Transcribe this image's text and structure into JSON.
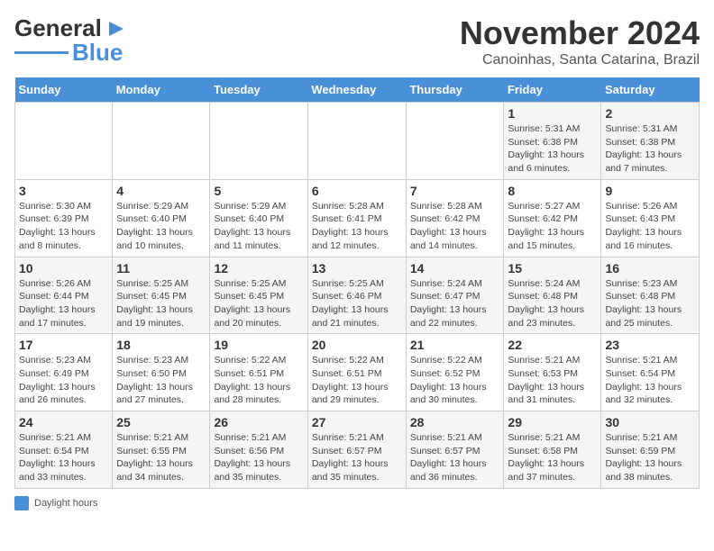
{
  "header": {
    "logo_line1": "General",
    "logo_line2": "Blue",
    "month": "November 2024",
    "location": "Canoinhas, Santa Catarina, Brazil"
  },
  "days_of_week": [
    "Sunday",
    "Monday",
    "Tuesday",
    "Wednesday",
    "Thursday",
    "Friday",
    "Saturday"
  ],
  "weeks": [
    [
      {
        "day": "",
        "info": ""
      },
      {
        "day": "",
        "info": ""
      },
      {
        "day": "",
        "info": ""
      },
      {
        "day": "",
        "info": ""
      },
      {
        "day": "",
        "info": ""
      },
      {
        "day": "1",
        "info": "Sunrise: 5:31 AM\nSunset: 6:38 PM\nDaylight: 13 hours and 6 minutes."
      },
      {
        "day": "2",
        "info": "Sunrise: 5:31 AM\nSunset: 6:38 PM\nDaylight: 13 hours and 7 minutes."
      }
    ],
    [
      {
        "day": "3",
        "info": "Sunrise: 5:30 AM\nSunset: 6:39 PM\nDaylight: 13 hours and 8 minutes."
      },
      {
        "day": "4",
        "info": "Sunrise: 5:29 AM\nSunset: 6:40 PM\nDaylight: 13 hours and 10 minutes."
      },
      {
        "day": "5",
        "info": "Sunrise: 5:29 AM\nSunset: 6:40 PM\nDaylight: 13 hours and 11 minutes."
      },
      {
        "day": "6",
        "info": "Sunrise: 5:28 AM\nSunset: 6:41 PM\nDaylight: 13 hours and 12 minutes."
      },
      {
        "day": "7",
        "info": "Sunrise: 5:28 AM\nSunset: 6:42 PM\nDaylight: 13 hours and 14 minutes."
      },
      {
        "day": "8",
        "info": "Sunrise: 5:27 AM\nSunset: 6:42 PM\nDaylight: 13 hours and 15 minutes."
      },
      {
        "day": "9",
        "info": "Sunrise: 5:26 AM\nSunset: 6:43 PM\nDaylight: 13 hours and 16 minutes."
      }
    ],
    [
      {
        "day": "10",
        "info": "Sunrise: 5:26 AM\nSunset: 6:44 PM\nDaylight: 13 hours and 17 minutes."
      },
      {
        "day": "11",
        "info": "Sunrise: 5:25 AM\nSunset: 6:45 PM\nDaylight: 13 hours and 19 minutes."
      },
      {
        "day": "12",
        "info": "Sunrise: 5:25 AM\nSunset: 6:45 PM\nDaylight: 13 hours and 20 minutes."
      },
      {
        "day": "13",
        "info": "Sunrise: 5:25 AM\nSunset: 6:46 PM\nDaylight: 13 hours and 21 minutes."
      },
      {
        "day": "14",
        "info": "Sunrise: 5:24 AM\nSunset: 6:47 PM\nDaylight: 13 hours and 22 minutes."
      },
      {
        "day": "15",
        "info": "Sunrise: 5:24 AM\nSunset: 6:48 PM\nDaylight: 13 hours and 23 minutes."
      },
      {
        "day": "16",
        "info": "Sunrise: 5:23 AM\nSunset: 6:48 PM\nDaylight: 13 hours and 25 minutes."
      }
    ],
    [
      {
        "day": "17",
        "info": "Sunrise: 5:23 AM\nSunset: 6:49 PM\nDaylight: 13 hours and 26 minutes."
      },
      {
        "day": "18",
        "info": "Sunrise: 5:23 AM\nSunset: 6:50 PM\nDaylight: 13 hours and 27 minutes."
      },
      {
        "day": "19",
        "info": "Sunrise: 5:22 AM\nSunset: 6:51 PM\nDaylight: 13 hours and 28 minutes."
      },
      {
        "day": "20",
        "info": "Sunrise: 5:22 AM\nSunset: 6:51 PM\nDaylight: 13 hours and 29 minutes."
      },
      {
        "day": "21",
        "info": "Sunrise: 5:22 AM\nSunset: 6:52 PM\nDaylight: 13 hours and 30 minutes."
      },
      {
        "day": "22",
        "info": "Sunrise: 5:21 AM\nSunset: 6:53 PM\nDaylight: 13 hours and 31 minutes."
      },
      {
        "day": "23",
        "info": "Sunrise: 5:21 AM\nSunset: 6:54 PM\nDaylight: 13 hours and 32 minutes."
      }
    ],
    [
      {
        "day": "24",
        "info": "Sunrise: 5:21 AM\nSunset: 6:54 PM\nDaylight: 13 hours and 33 minutes."
      },
      {
        "day": "25",
        "info": "Sunrise: 5:21 AM\nSunset: 6:55 PM\nDaylight: 13 hours and 34 minutes."
      },
      {
        "day": "26",
        "info": "Sunrise: 5:21 AM\nSunset: 6:56 PM\nDaylight: 13 hours and 35 minutes."
      },
      {
        "day": "27",
        "info": "Sunrise: 5:21 AM\nSunset: 6:57 PM\nDaylight: 13 hours and 35 minutes."
      },
      {
        "day": "28",
        "info": "Sunrise: 5:21 AM\nSunset: 6:57 PM\nDaylight: 13 hours and 36 minutes."
      },
      {
        "day": "29",
        "info": "Sunrise: 5:21 AM\nSunset: 6:58 PM\nDaylight: 13 hours and 37 minutes."
      },
      {
        "day": "30",
        "info": "Sunrise: 5:21 AM\nSunset: 6:59 PM\nDaylight: 13 hours and 38 minutes."
      }
    ]
  ],
  "legend": {
    "daylight_hours_label": "Daylight hours"
  }
}
